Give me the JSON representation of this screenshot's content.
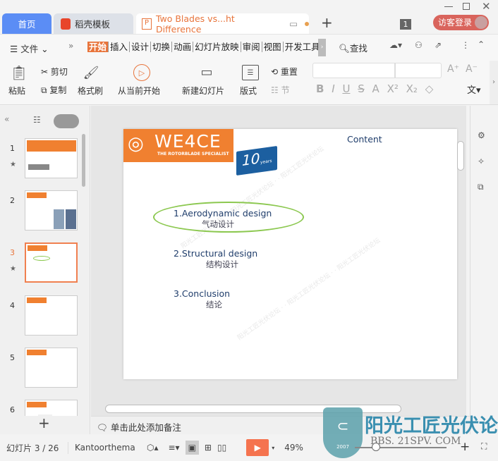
{
  "window": {
    "controls": [
      "minimize",
      "maximize",
      "close"
    ]
  },
  "tabs": [
    {
      "label": "首页",
      "active": false
    },
    {
      "label": "稻壳模板",
      "active": false
    },
    {
      "label": "Two Blades vs...ht Difference",
      "active": true
    }
  ],
  "tab_add": "+",
  "badge_count": "1",
  "login_label": "访客登录",
  "menu": {
    "file": "文件",
    "items": [
      "开始",
      "插入",
      "设计",
      "切换",
      "动画",
      "幻灯片放映",
      "审阅",
      "视图",
      "开发工具"
    ],
    "active": "开始",
    "search": "查找"
  },
  "toolbar": {
    "paste": "粘贴",
    "cut": "剪切",
    "copy": "复制",
    "format_painter": "格式刷",
    "play_from_current": "从当前开始",
    "new_slide": "新建幻灯片",
    "layout": "版式",
    "reset": "重置",
    "section": "节"
  },
  "slides": {
    "numbers": [
      "1",
      "2",
      "3",
      "4",
      "5",
      "6"
    ],
    "current": 3
  },
  "slide": {
    "logo_text": "WE4CE",
    "logo_tagline": "THE ROTORBLADE SPECIALIST",
    "flag_text": "10",
    "flag_sub": "years",
    "title": "Content",
    "items": [
      {
        "en": "1.Aerodynamic design",
        "zh": "气动设计",
        "highlighted": true
      },
      {
        "en": "2.Structural design",
        "zh": "结构设计",
        "highlighted": false
      },
      {
        "en": "3.Conclusion",
        "zh": "结论",
        "highlighted": false
      }
    ]
  },
  "notes_placeholder": "单击此处添加备注",
  "status": {
    "slide_counter": "幻灯片 3 / 26",
    "theme": "Kantoorthema",
    "zoom": "49%",
    "zoom_fraction": 0.49
  },
  "watermark": {
    "text": "阳光工匠光伏论坛",
    "url": "BBS. 21SPV. COM",
    "year": "2007"
  },
  "colors": {
    "accent": "#e8743b",
    "tab_home": "#5b8df5",
    "login": "#d9645c",
    "ellipse": "#8cc850",
    "slide_text": "#1f3d6b",
    "logo_orange": "#f08030",
    "play": "#f5734f"
  }
}
